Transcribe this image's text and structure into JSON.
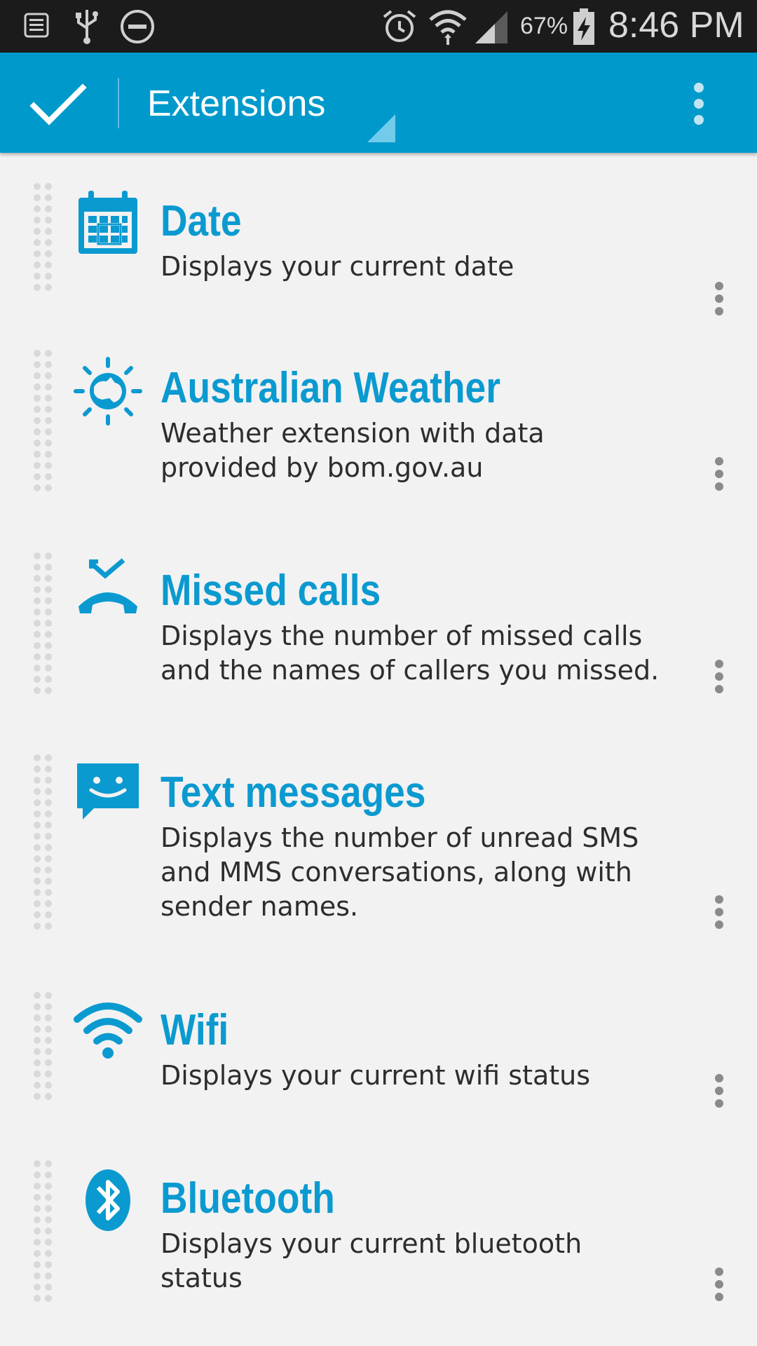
{
  "status_bar": {
    "battery_percent": "67%",
    "time": "8:46 PM",
    "icons": [
      "notification-icon",
      "usb-icon",
      "do-not-disturb-icon",
      "alarm-icon",
      "wifi-icon",
      "signal-icon",
      "battery-charging-icon"
    ]
  },
  "action_bar": {
    "title": "Extensions",
    "done_icon": "check-icon",
    "overflow_icon": "more-vert-icon",
    "background": "#0099cc"
  },
  "extensions": [
    {
      "title": "Date",
      "description": "Displays your current date",
      "icon": "calendar-icon"
    },
    {
      "title": "Australian Weather",
      "description": "Weather extension with data provided by bom.gov.au",
      "icon": "weather-australia-icon"
    },
    {
      "title": "Missed calls",
      "description": "Displays the number of missed calls and the names of callers you missed.",
      "icon": "missed-call-icon"
    },
    {
      "title": "Text messages",
      "description": "Displays the number of unread SMS and MMS conversations, along with sender names.",
      "icon": "sms-icon"
    },
    {
      "title": "Wifi",
      "description": "Displays your current wifi status",
      "icon": "wifi-icon"
    },
    {
      "title": "Bluetooth",
      "description": "Displays your current bluetooth status",
      "icon": "bluetooth-icon"
    }
  ],
  "colors": {
    "accent": "#0b9ad0",
    "background": "#f2f2f2",
    "text": "#2d2d2d"
  }
}
